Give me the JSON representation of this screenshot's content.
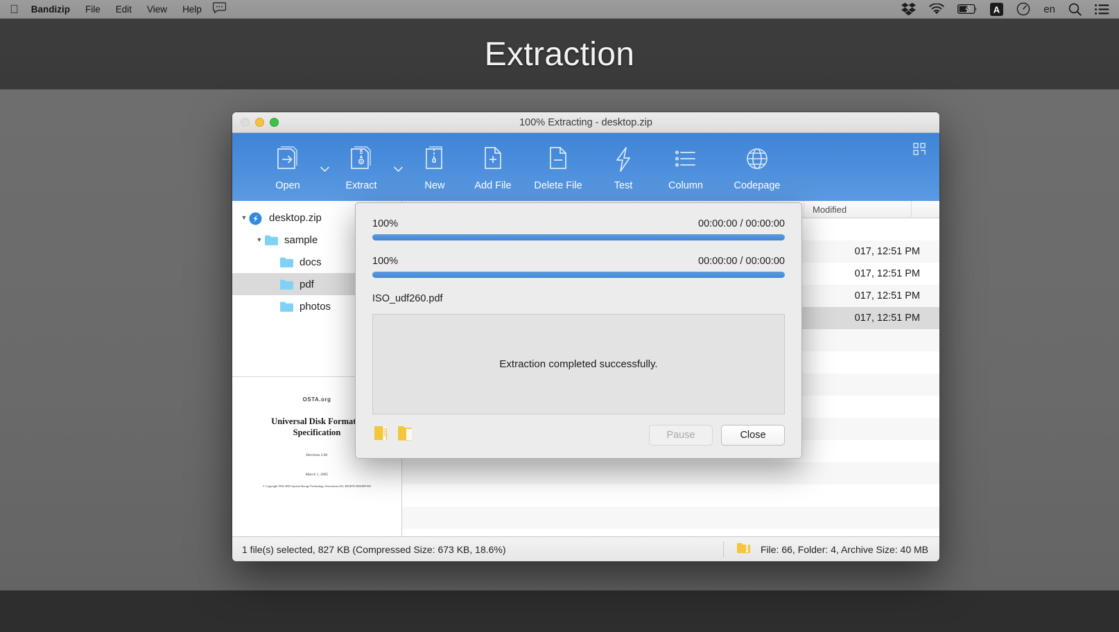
{
  "menubar": {
    "apple_glyph": "apple-logo",
    "items": [
      {
        "label": "Bandizip",
        "bold": true
      },
      {
        "label": "File",
        "bold": false
      },
      {
        "label": "Edit",
        "bold": false
      },
      {
        "label": "View",
        "bold": false
      },
      {
        "label": "Help",
        "bold": false
      }
    ],
    "speech_icon": "speech-bubble-icon",
    "tray": [
      {
        "name": "dropbox-icon"
      },
      {
        "name": "wifi-icon"
      },
      {
        "name": "battery-charging-icon"
      },
      {
        "name": "text-input-source-icon",
        "label": "A"
      },
      {
        "name": "timer-icon"
      },
      {
        "name": "input-language-indicator",
        "label": "en"
      },
      {
        "name": "spotlight-search-icon"
      },
      {
        "name": "notification-center-icon"
      }
    ]
  },
  "hero": {
    "title": "Extraction"
  },
  "window": {
    "title": "100% Extracting - desktop.zip",
    "traffic": {
      "close": "close-button",
      "minimize": "minimize-button",
      "zoom": "zoom-button"
    },
    "toolbar": {
      "buttons": [
        {
          "label": "Open",
          "icon": "open-archive-icon",
          "has_caret": true
        },
        {
          "label": "Extract",
          "icon": "extract-archive-icon",
          "has_caret": true
        },
        {
          "label": "New",
          "icon": "new-archive-icon",
          "has_caret": false
        },
        {
          "label": "Add File",
          "icon": "add-file-icon",
          "has_caret": false
        },
        {
          "label": "Delete File",
          "icon": "delete-file-icon",
          "has_caret": false
        },
        {
          "label": "Test",
          "icon": "test-archive-icon",
          "has_caret": false
        },
        {
          "label": "Column",
          "icon": "column-list-icon",
          "has_caret": false
        },
        {
          "label": "Codepage",
          "icon": "codepage-globe-icon",
          "has_caret": false
        }
      ],
      "grid_icon": "view-grid-icon"
    },
    "tree": [
      {
        "label": "desktop.zip",
        "icon": "bandizip-archive-icon",
        "depth": 0,
        "twisty": "▼",
        "selected": false
      },
      {
        "label": "sample",
        "icon": "folder-icon",
        "depth": 1,
        "twisty": "▼",
        "selected": false
      },
      {
        "label": "docs",
        "icon": "folder-icon",
        "depth": 2,
        "twisty": "",
        "selected": false
      },
      {
        "label": "pdf",
        "icon": "folder-icon",
        "depth": 2,
        "twisty": "",
        "selected": true
      },
      {
        "label": "photos",
        "icon": "folder-icon",
        "depth": 2,
        "twisty": "",
        "selected": false
      }
    ],
    "preview": {
      "name": "pdf-preview-thumbnail",
      "logo": "OSTA.org",
      "title": "Universal Disk Format® Specification",
      "revision": "Revision 2.60",
      "date": "March 1, 2005",
      "copyright": "© Copyright 1994-2005 Optical Storage Technology Association ALL RIGHTS RESERVED"
    },
    "list": {
      "columns": [
        {
          "label": ""
        },
        {
          "label": "Modified"
        },
        {
          "label": ""
        }
      ],
      "rows": [
        {
          "modified": "",
          "alt": false,
          "selected": false
        },
        {
          "modified": "017, 12:51 PM",
          "alt": true,
          "selected": false
        },
        {
          "modified": "017, 12:51 PM",
          "alt": false,
          "selected": false
        },
        {
          "modified": "017, 12:51 PM",
          "alt": true,
          "selected": false
        },
        {
          "modified": "017, 12:51 PM",
          "alt": false,
          "selected": true
        },
        {
          "modified": "",
          "alt": true,
          "selected": false
        },
        {
          "modified": "",
          "alt": false,
          "selected": false
        },
        {
          "modified": "",
          "alt": true,
          "selected": false
        },
        {
          "modified": "",
          "alt": false,
          "selected": false
        },
        {
          "modified": "",
          "alt": true,
          "selected": false
        },
        {
          "modified": "",
          "alt": false,
          "selected": false
        },
        {
          "modified": "",
          "alt": true,
          "selected": false
        },
        {
          "modified": "",
          "alt": false,
          "selected": false
        },
        {
          "modified": "",
          "alt": true,
          "selected": false
        }
      ]
    },
    "statusbar": {
      "left": "1 file(s) selected, 827 KB (Compressed Size: 673 KB, 18.6%)",
      "folder_icon": "archive-folder-icon",
      "right": "File: 66, Folder: 4, Archive Size: 40 MB"
    }
  },
  "dialog": {
    "progress": [
      {
        "percent_label": "100%",
        "percent_value": 100,
        "time_label": "00:00:00 / 00:00:00"
      },
      {
        "percent_label": "100%",
        "percent_value": 100,
        "time_label": "00:00:00 / 00:00:00"
      }
    ],
    "current_file": "ISO_udf260.pdf",
    "message": "Extraction completed successfully.",
    "folder_buttons": [
      {
        "name": "open-archive-folder-icon"
      },
      {
        "name": "open-destination-folder-icon"
      }
    ],
    "buttons": [
      {
        "label": "Pause",
        "disabled": true
      },
      {
        "label": "Close",
        "disabled": false
      }
    ]
  },
  "colors": {
    "toolbar_blue": "#4a8ddb",
    "progress_blue": "#4e8fd8",
    "selection_gray": "#dadada",
    "folder_yellow": "#f4c23c"
  }
}
